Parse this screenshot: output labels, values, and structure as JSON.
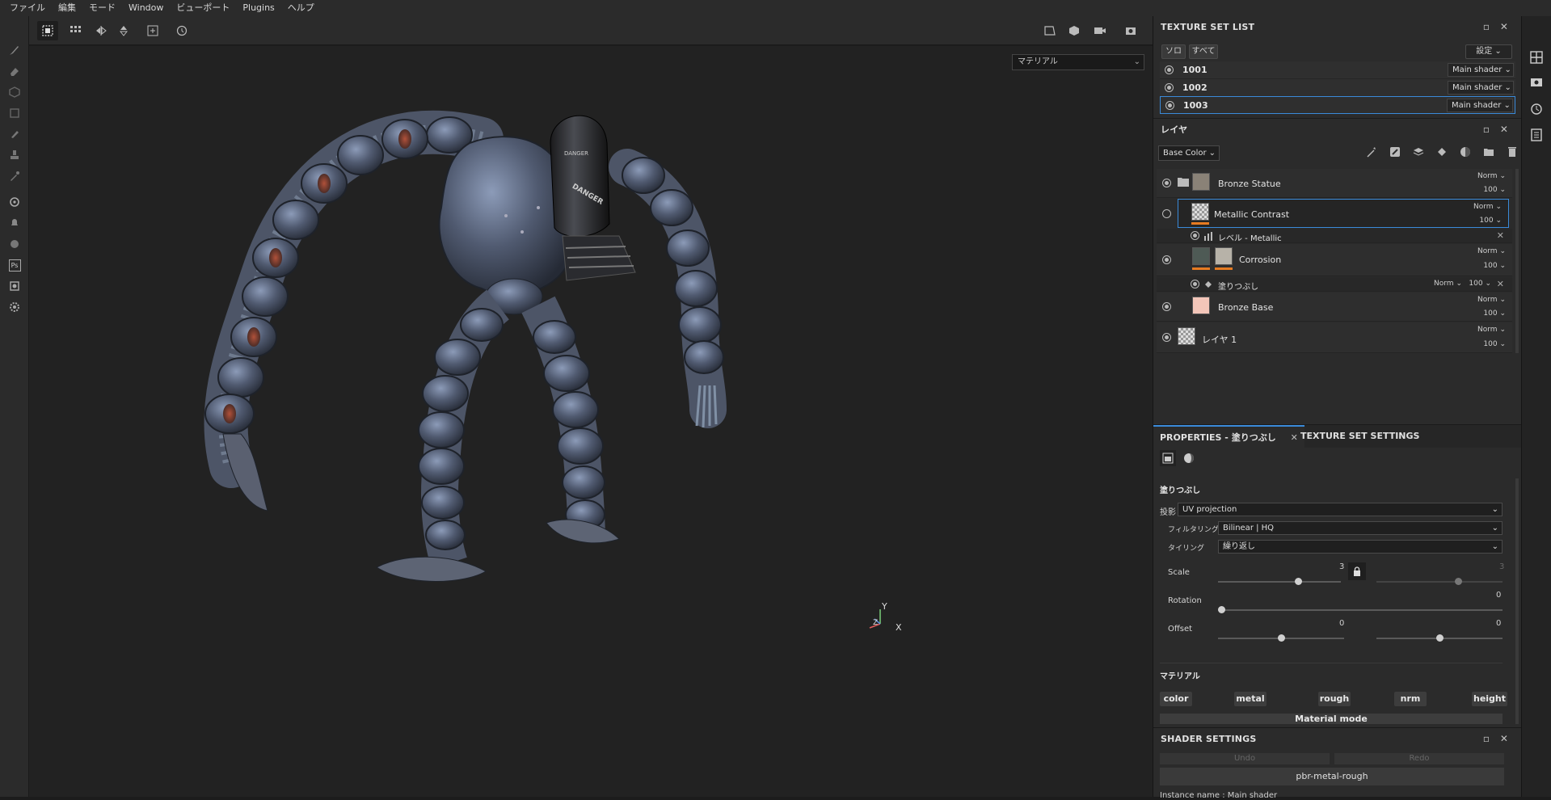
{
  "menu": [
    "ファイル",
    "編集",
    "モード",
    "Window",
    "ビューポート",
    "Plugins",
    "ヘルプ"
  ],
  "viewport": {
    "material_mode": "マテリアル",
    "axis": {
      "x": "X",
      "y": "Y",
      "z": "Z"
    },
    "model_text": {
      "danger1": "DANGER",
      "danger2": "DANGER"
    }
  },
  "texture_set_list": {
    "title": "TEXTURE SET LIST",
    "solo": "ソロ",
    "all": "すべて",
    "settings": "設定",
    "sets": [
      {
        "name": "1001",
        "shader": "Main shader"
      },
      {
        "name": "1002",
        "shader": "Main shader"
      },
      {
        "name": "1003",
        "shader": "Main shader"
      }
    ]
  },
  "layers": {
    "title": "レイヤ",
    "channel": "Base Color",
    "items": [
      {
        "name": "Bronze Statue",
        "blend": "Norm",
        "opacity": "100"
      },
      {
        "name": "Metallic Contrast",
        "blend": "Norm",
        "opacity": "100"
      },
      {
        "name": "レベル - Metallic"
      },
      {
        "name": "Corrosion",
        "blend": "Norm",
        "opacity": "100"
      },
      {
        "name": "塗りつぶし",
        "blend": "Norm",
        "opacity": "100"
      },
      {
        "name": "Bronze Base",
        "blend": "Norm",
        "opacity": "100"
      },
      {
        "name": "レイヤ 1",
        "blend": "Norm",
        "opacity": "100"
      }
    ]
  },
  "properties": {
    "tab_properties": "PROPERTIES - 塗りつぶし",
    "tab_texture_set": "TEXTURE SET SETTINGS",
    "section_title": "塗りつぶし",
    "projection_label": "投影",
    "projection_value": "UV projection",
    "filtering_label": "フィルタリング",
    "filtering_value": "Bilinear | HQ",
    "tiling_label": "タイリング",
    "tiling_value": "繰り返し",
    "scale_label": "Scale",
    "scale_values": [
      "3",
      "3"
    ],
    "scale_level": [
      0.65,
      0.65
    ],
    "rotation_label": "Rotation",
    "rotation_value": "0",
    "offset_label": "Offset",
    "offset_values": [
      "0",
      "0"
    ],
    "material_title": "マテリアル",
    "channels": [
      "color",
      "metal",
      "rough",
      "nrm",
      "height"
    ],
    "material_mode": "Material mode"
  },
  "shader_settings": {
    "title": "SHADER SETTINGS",
    "undo": "Undo",
    "redo": "Redo",
    "shader": "pbr-metal-rough",
    "instance_label": "Instance name : Main shader"
  },
  "colors": {
    "accent": "#3a8ad9",
    "orange": "#e67b22"
  }
}
